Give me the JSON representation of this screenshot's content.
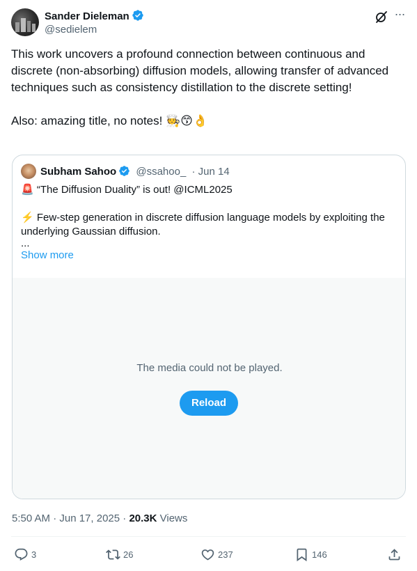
{
  "author": {
    "name": "Sander Dieleman",
    "handle": "@sedielem"
  },
  "post": {
    "paragraph1": "This work uncovers a profound connection between continuous and discrete (non-absorbing) diffusion models, allowing transfer of advanced techniques such as consistency distillation to the discrete setting!",
    "paragraph2": "Also: amazing title, no notes! 🧑‍🍳😙👌"
  },
  "quote": {
    "name": "Subham Sahoo",
    "handle": "@ssahoo_",
    "date": "· Jun 14",
    "line1": "🚨 “The Diffusion Duality” is out! @ICML2025",
    "line2": "⚡️ Few-step generation in discrete diffusion language models by exploiting the underlying Gaussian diffusion.",
    "ellipsis": "...",
    "show_more": "Show more",
    "media_message": "The media could not be played.",
    "reload_label": "Reload"
  },
  "meta": {
    "time": "5:50 AM · Jun 17, 2025 · ",
    "views_count": "20.3K",
    "views_label": " Views"
  },
  "actions": {
    "replies": "3",
    "reposts": "26",
    "likes": "237",
    "bookmarks": "146"
  },
  "colors": {
    "accent": "#1d9bf0",
    "text": "#0f1419",
    "secondary": "#536471",
    "border": "#cfd9de"
  },
  "icons": [
    "verified-icon",
    "grok-icon",
    "more-icon",
    "reply-icon",
    "repost-icon",
    "like-icon",
    "bookmark-icon",
    "share-icon"
  ]
}
